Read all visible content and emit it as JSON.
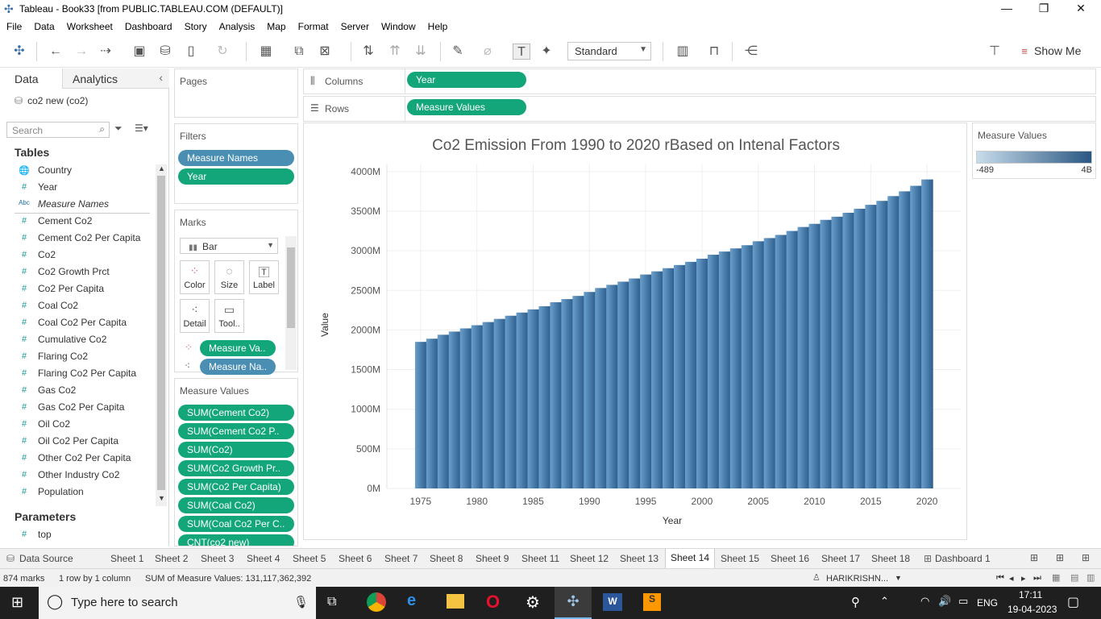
{
  "window": {
    "title": "Tableau - Book33 [from PUBLIC.TABLEAU.COM (DEFAULT)]"
  },
  "menu": [
    "File",
    "Data",
    "Worksheet",
    "Dashboard",
    "Story",
    "Analysis",
    "Map",
    "Format",
    "Server",
    "Window",
    "Help"
  ],
  "toolbar": {
    "fit_select": "Standard",
    "show_me": "Show Me"
  },
  "data_pane": {
    "tab_data": "Data",
    "tab_analytics": "Analytics",
    "datasource": "co2 new (co2)",
    "search_placeholder": "Search",
    "tables_heading": "Tables",
    "fields": [
      {
        "icon": "globe",
        "label": "Country"
      },
      {
        "icon": "#",
        "label": "Year"
      },
      {
        "icon": "Abc",
        "label": "Measure Names"
      },
      {
        "icon": "#",
        "label": "Cement Co2"
      },
      {
        "icon": "#",
        "label": "Cement Co2 Per Capita"
      },
      {
        "icon": "#",
        "label": "Co2"
      },
      {
        "icon": "#",
        "label": "Co2 Growth Prct"
      },
      {
        "icon": "#",
        "label": "Co2 Per Capita"
      },
      {
        "icon": "#",
        "label": "Coal Co2"
      },
      {
        "icon": "#",
        "label": "Coal Co2 Per Capita"
      },
      {
        "icon": "#",
        "label": "Cumulative Co2"
      },
      {
        "icon": "#",
        "label": "Flaring Co2"
      },
      {
        "icon": "#",
        "label": "Flaring Co2 Per Capita"
      },
      {
        "icon": "#",
        "label": "Gas Co2"
      },
      {
        "icon": "#",
        "label": "Gas Co2 Per Capita"
      },
      {
        "icon": "#",
        "label": "Oil Co2"
      },
      {
        "icon": "#",
        "label": "Oil Co2 Per Capita"
      },
      {
        "icon": "#",
        "label": "Other Co2 Per Capita"
      },
      {
        "icon": "#",
        "label": "Other Industry Co2"
      },
      {
        "icon": "#",
        "label": "Population"
      }
    ],
    "parameters_heading": "Parameters",
    "parameters": [
      {
        "icon": "#",
        "label": "top"
      }
    ]
  },
  "shelves": {
    "pages": "Pages",
    "filters": "Filters",
    "filter_pills": [
      "Measure Names",
      "Year"
    ],
    "marks": "Marks",
    "mark_type": "Bar",
    "mark_buttons": [
      "Color",
      "Size",
      "Label",
      "Detail",
      "Tool.."
    ],
    "mark_pills": [
      "Measure Va..",
      "Measure Na.."
    ],
    "measure_values_title": "Measure Values",
    "measure_values": [
      "SUM(Cement Co2)",
      "SUM(Cement Co2 P..",
      "SUM(Co2)",
      "SUM(Co2 Growth Pr..",
      "SUM(Co2 Per Capita)",
      "SUM(Coal Co2)",
      "SUM(Coal Co2 Per C..",
      "CNT(co2 new)"
    ],
    "columns_label": "Columns",
    "columns_pill": "Year",
    "rows_label": "Rows",
    "rows_pill": "Measure Values"
  },
  "legend": {
    "title": "Measure Values",
    "min": "-489",
    "max": "4B",
    "color_low": "#c8dcea",
    "color_high": "#2a5783"
  },
  "chart_data": {
    "type": "area",
    "title": "Co2 Emission From 1990 to 2020 rBased on Intenal Factors",
    "xlabel": "Year",
    "ylabel": "Value",
    "xlim": [
      1972,
      2023
    ],
    "ylim": [
      0,
      4100
    ],
    "x_ticks": [
      "1975",
      "1980",
      "1985",
      "1990",
      "1995",
      "2000",
      "2005",
      "2010",
      "2015",
      "2020"
    ],
    "y_ticks": [
      "0M",
      "500M",
      "1000M",
      "1500M",
      "2000M",
      "2500M",
      "3000M",
      "3500M",
      "4000M"
    ],
    "unit": "M",
    "x": [
      1975,
      1976,
      1977,
      1978,
      1979,
      1980,
      1981,
      1982,
      1983,
      1984,
      1985,
      1986,
      1987,
      1988,
      1989,
      1990,
      1991,
      1992,
      1993,
      1994,
      1995,
      1996,
      1997,
      1998,
      1999,
      2000,
      2001,
      2002,
      2003,
      2004,
      2005,
      2006,
      2007,
      2008,
      2009,
      2010,
      2011,
      2012,
      2013,
      2014,
      2015,
      2016,
      2017,
      2018,
      2019,
      2020
    ],
    "values": [
      1850,
      1890,
      1940,
      1980,
      2020,
      2060,
      2100,
      2140,
      2180,
      2220,
      2260,
      2300,
      2350,
      2390,
      2430,
      2480,
      2530,
      2570,
      2610,
      2650,
      2700,
      2740,
      2780,
      2820,
      2860,
      2900,
      2950,
      2990,
      3030,
      3070,
      3120,
      3160,
      3200,
      3250,
      3300,
      3340,
      3390,
      3430,
      3480,
      3530,
      3580,
      3630,
      3690,
      3750,
      3820,
      3900
    ],
    "grid": true
  },
  "sheet_tabs": [
    "Data Source",
    "Sheet 1",
    "Sheet 2",
    "Sheet 3",
    "Sheet 4",
    "Sheet 5",
    "Sheet 6",
    "Sheet 7",
    "Sheet 8",
    "Sheet 9",
    "Sheet 11",
    "Sheet 12",
    "Sheet 13",
    "Sheet 14",
    "Sheet 15",
    "Sheet 16",
    "Sheet 17",
    "Sheet 18",
    "Dashboard 1"
  ],
  "active_tab": "Sheet 14",
  "status": {
    "marks": "874 marks",
    "rows_cols": "1 row by 1 column",
    "sum": "SUM of Measure Values: 131,117,362,392",
    "user": "HARIKRISHN..."
  },
  "taskbar": {
    "search_placeholder": "Type here to search",
    "lang": "ENG",
    "time": "17:11",
    "date": "19-04-2023"
  }
}
